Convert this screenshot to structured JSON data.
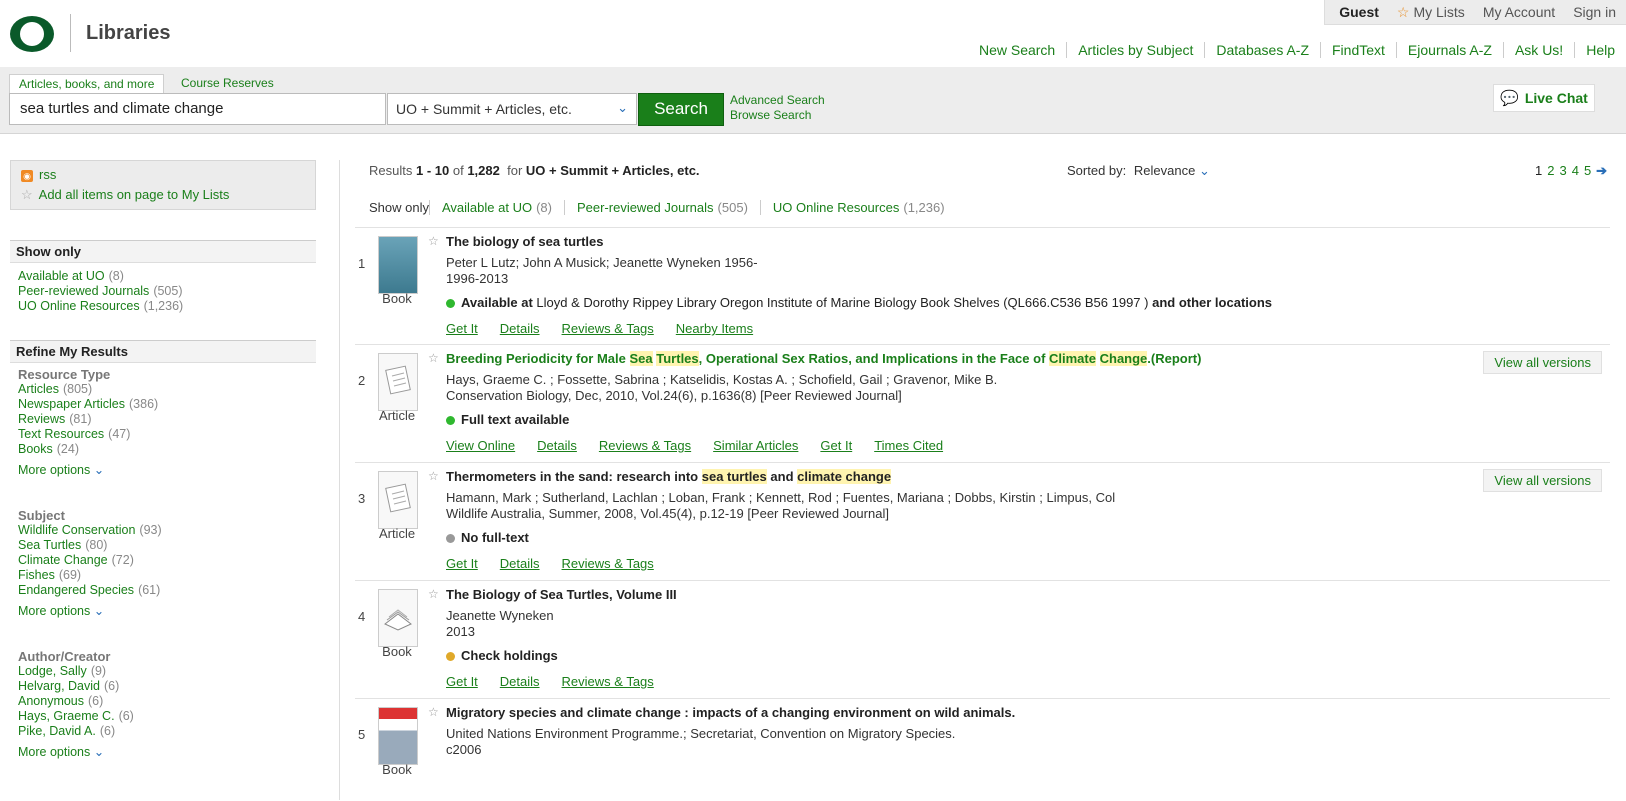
{
  "header": {
    "library_name": "Libraries",
    "account": {
      "guest": "Guest",
      "my_lists": "My Lists",
      "my_account": "My Account",
      "sign_in": "Sign in"
    },
    "nav": [
      "New Search",
      "Articles by Subject",
      "Databases A-Z",
      "FindText",
      "Ejournals A-Z",
      "Ask Us!",
      "Help"
    ],
    "brand_color": "#1a7f1a"
  },
  "search": {
    "tab_active": "Articles, books, and more",
    "tab_other": "Course Reserves",
    "query": "sea turtles and climate change",
    "scope": "UO + Summit + Articles, etc.",
    "button": "Search",
    "advanced": "Advanced Search",
    "browse": "Browse Search",
    "live_chat": "Live Chat"
  },
  "sidebar": {
    "rss": "rss",
    "add_all": "Add all items on page to My Lists",
    "show_only_title": "Show only",
    "show_only": [
      {
        "label": "Available at UO",
        "count": "(8)"
      },
      {
        "label": "Peer-reviewed Journals",
        "count": "(505)"
      },
      {
        "label": "UO Online Resources",
        "count": "(1,236)"
      }
    ],
    "refine_title": "Refine My Results",
    "more_options": "More options",
    "facets": [
      {
        "title": "Resource Type",
        "items": [
          {
            "label": "Articles",
            "count": "(805)"
          },
          {
            "label": "Newspaper Articles",
            "count": "(386)"
          },
          {
            "label": "Reviews",
            "count": "(81)"
          },
          {
            "label": "Text Resources",
            "count": "(47)"
          },
          {
            "label": "Books",
            "count": "(24)"
          }
        ]
      },
      {
        "title": "Subject",
        "items": [
          {
            "label": "Wildlife Conservation",
            "count": "(93)"
          },
          {
            "label": "Sea Turtles",
            "count": "(80)"
          },
          {
            "label": "Climate Change",
            "count": "(72)"
          },
          {
            "label": "Fishes",
            "count": "(69)"
          },
          {
            "label": "Endangered Species",
            "count": "(61)"
          }
        ]
      },
      {
        "title": "Author/Creator",
        "items": [
          {
            "label": "Lodge, Sally",
            "count": "(9)"
          },
          {
            "label": "Helvarg, David",
            "count": "(6)"
          },
          {
            "label": "Anonymous",
            "count": "(6)"
          },
          {
            "label": "Hays, Graeme C.",
            "count": "(6)"
          },
          {
            "label": "Pike, David A.",
            "count": "(6)"
          }
        ]
      }
    ]
  },
  "results_header": {
    "prefix": "Results",
    "range": "1 - 10",
    "of": "of",
    "total": "1,282",
    "for": "for",
    "scope": "UO + Summit + Articles, etc.",
    "sorted_label": "Sorted by:",
    "sorted_value": "Relevance",
    "pages": [
      "1",
      "2",
      "3",
      "4",
      "5"
    ],
    "show_only_label": "Show only",
    "filters": [
      {
        "label": "Available at UO",
        "count": "(8)"
      },
      {
        "label": "Peer-reviewed Journals",
        "count": "(505)"
      },
      {
        "label": "UO Online Resources",
        "count": "(1,236)"
      }
    ]
  },
  "results": [
    {
      "num": "1",
      "type": "Book",
      "title": "The biology of sea turtles",
      "line1": "Peter L Lutz; John A Musick; Jeanette Wyneken 1956-",
      "line2": "1996-2013",
      "status_bold": "Available at",
      "status_text": "Lloyd & Dorothy Rippey Library Oregon Institute of Marine Biology Book Shelves (QL666.C536 B56 1997 )",
      "status_tail": "and other locations",
      "links": [
        "Get It",
        "Details",
        "Reviews & Tags",
        "Nearby Items"
      ]
    },
    {
      "num": "2",
      "type": "Article",
      "title_parts": [
        "Breeding Periodicity for Male ",
        "Sea",
        " ",
        "Turtles",
        ", Operational Sex Ratios, and Implications in the Face of ",
        "Climate",
        " ",
        "Change",
        ".(Report)"
      ],
      "line1": "Hays, Graeme C. ; Fossette, Sabrina ; Katselidis, Kostas A. ; Schofield, Gail ; Gravenor, Mike B.",
      "line2": "Conservation Biology, Dec, 2010, Vol.24(6), p.1636(8) [Peer Reviewed Journal]",
      "status_bold": "Full text available",
      "links": [
        "View Online",
        "Details",
        "Reviews & Tags",
        "Similar Articles",
        "Get It",
        "Times Cited"
      ],
      "versions": "View all versions"
    },
    {
      "num": "3",
      "type": "Article",
      "title_parts": [
        "Thermometers in the sand: research into ",
        "sea turtles",
        " and ",
        "climate change"
      ],
      "line1": "Hamann, Mark ; Sutherland, Lachlan ; Loban, Frank ; Kennett, Rod ; Fuentes, Mariana ; Dobbs, Kirstin ; Limpus, Col",
      "line2": "Wildlife Australia, Summer, 2008, Vol.45(4), p.12-19 [Peer Reviewed Journal]",
      "status_bold": "No full-text",
      "links": [
        "Get It",
        "Details",
        "Reviews & Tags"
      ],
      "versions": "View all versions"
    },
    {
      "num": "4",
      "type": "Book",
      "title": "The Biology of Sea Turtles, Volume III",
      "line1": "Jeanette Wyneken",
      "line2": "2013",
      "status_bold": "Check holdings",
      "links": [
        "Get It",
        "Details",
        "Reviews & Tags"
      ]
    },
    {
      "num": "5",
      "type": "Book",
      "title": "Migratory species and climate change : impacts of a changing environment on wild animals.",
      "line1": "United Nations Environment Programme.; Secretariat, Convention on Migratory Species.",
      "line2": "c2006"
    }
  ],
  "status_colors": {
    "available": "#2fb82f",
    "none": "#999999",
    "check": "#e0a92a"
  }
}
